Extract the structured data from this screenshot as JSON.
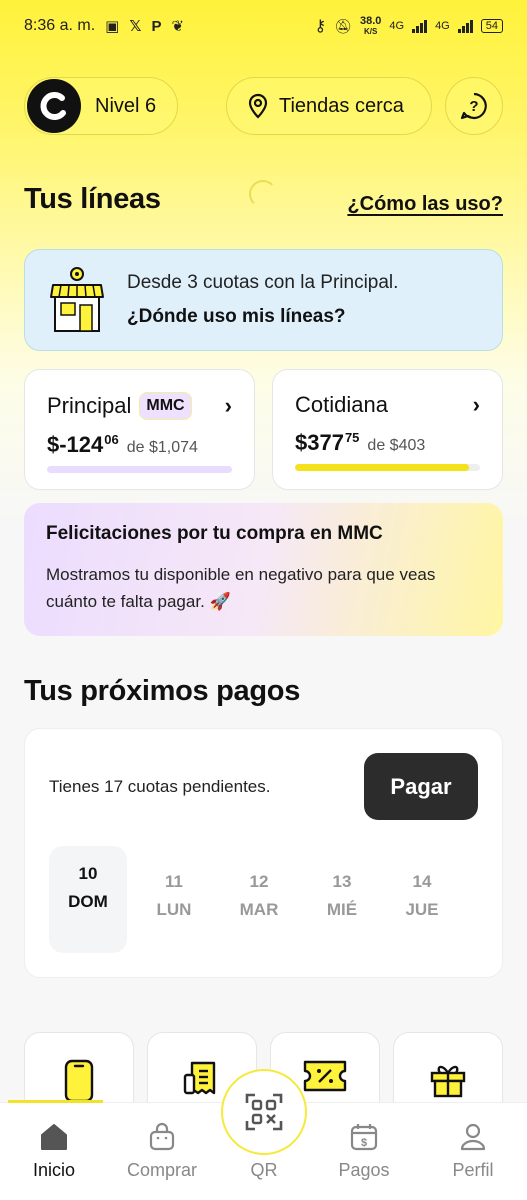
{
  "status_bar": {
    "time": "8:36 a. m.",
    "net_speed": "38.0",
    "net_unit": "K/S",
    "net_type_1": "4G",
    "net_type_2": "4G",
    "battery": "54"
  },
  "header": {
    "level_label": "Nivel 6",
    "stores_label": "Tiendas cerca"
  },
  "lines": {
    "title": "Tus líneas",
    "how_link": "¿Cómo las uso?",
    "info_text": "Desde 3 cuotas con la Principal.",
    "info_link": "¿Dónde uso mis líneas?",
    "principal": {
      "name": "Principal",
      "badge": "MMC",
      "amount": "$-124",
      "cents": "06",
      "limit": "de $1,074",
      "usage_fraction": 1.0,
      "bar_color": "#e9dcff"
    },
    "cotidiana": {
      "name": "Cotidiana",
      "amount": "$377",
      "cents": "75",
      "limit": "de $403",
      "usage_fraction": 0.94,
      "bar_color": "#f5e01c"
    }
  },
  "promo": {
    "title": "Felicitaciones por tu compra en MMC",
    "message": "Mostramos tu disponible en negativo para que veas cuánto te falta pagar. 🚀"
  },
  "payments": {
    "title": "Tus próximos pagos",
    "pending_text": "Tienes 17 cuotas pendientes.",
    "pay_button": "Pagar",
    "days": [
      {
        "num": "10",
        "name": "DOM",
        "selected": true
      },
      {
        "num": "11",
        "name": "LUN",
        "selected": false
      },
      {
        "num": "12",
        "name": "MAR",
        "selected": false
      },
      {
        "num": "13",
        "name": "MIÉ",
        "selected": false
      },
      {
        "num": "14",
        "name": "JUE",
        "selected": false
      }
    ]
  },
  "shortcuts": [
    "phone-icon",
    "receipt-icon",
    "discount-ticket-icon",
    "gift-icon"
  ],
  "nav": {
    "home": "Inicio",
    "shop": "Comprar",
    "qr": "QR",
    "payments": "Pagos",
    "profile": "Perfil"
  },
  "colors": {
    "brand_yellow": "#fff23a",
    "dark": "#2c2c2c",
    "info_bg": "#dff0fb"
  }
}
